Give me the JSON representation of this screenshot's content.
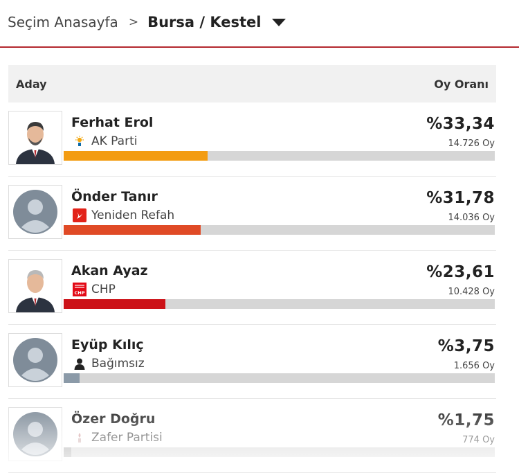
{
  "breadcrumb": {
    "home": "Seçim Anasayfa",
    "separator": ">",
    "current": "Bursa / Kestel"
  },
  "table": {
    "col_candidate": "Aday",
    "col_share": "Oy Oranı"
  },
  "candidates": [
    {
      "name": "Ferhat Erol",
      "party": "AK Parti",
      "party_icon": "ak-parti-logo-icon",
      "avatar": "photo",
      "percent": "%33,34",
      "share": 33.34,
      "votes": "14.726 Oy",
      "color": "#f39c12"
    },
    {
      "name": "Önder Tanır",
      "party": "Yeniden Refah",
      "party_icon": "yeniden-refah-logo-icon",
      "avatar": "placeholder",
      "percent": "%31,78",
      "share": 31.78,
      "votes": "14.036 Oy",
      "color": "#e04a26"
    },
    {
      "name": "Akan Ayaz",
      "party": "CHP",
      "party_icon": "chp-logo-icon",
      "avatar": "photo",
      "percent": "%23,61",
      "share": 23.61,
      "votes": "10.428 Oy",
      "color": "#cc1218"
    },
    {
      "name": "Eyüp Kılıç",
      "party": "Bağımsız",
      "party_icon": "person-icon",
      "avatar": "placeholder",
      "percent": "%3,75",
      "share": 3.75,
      "votes": "1.656 Oy",
      "color": "#8b9aa8"
    },
    {
      "name": "Özer Doğru",
      "party": "Zafer Partisi",
      "party_icon": "zafer-partisi-logo-icon",
      "avatar": "placeholder",
      "percent": "%1,75",
      "share": 1.75,
      "votes": "774 Oy",
      "color": "#a8a8a8"
    }
  ]
}
